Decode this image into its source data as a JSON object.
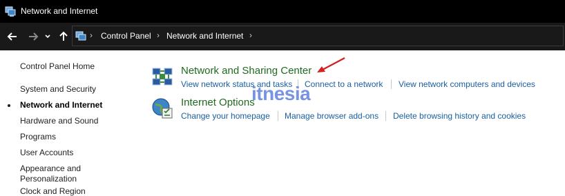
{
  "window": {
    "title": "Network and Internet"
  },
  "nav": {
    "back_icon": "back-arrow-icon",
    "forward_icon": "forward-arrow-icon",
    "recent_icon": "chevron-down-icon",
    "up_icon": "up-arrow-icon"
  },
  "address": {
    "crumbs": [
      "Control Panel",
      "Network and Internet"
    ],
    "separator": "›"
  },
  "sidebar": {
    "home": "Control Panel Home",
    "items": [
      {
        "label": "System and Security"
      },
      {
        "label": "Network and Internet",
        "current": true
      },
      {
        "label": "Hardware and Sound"
      },
      {
        "label": "Programs"
      },
      {
        "label": "User Accounts"
      },
      {
        "label": "Appearance and Personalization"
      },
      {
        "label": "Clock and Region"
      }
    ]
  },
  "categories": [
    {
      "title": "Network and Sharing Center",
      "icon": "network-sharing-icon",
      "tasks": [
        "View network status and tasks",
        "Connect to a network",
        "View network computers and devices"
      ]
    },
    {
      "title": "Internet Options",
      "icon": "internet-options-icon",
      "tasks": [
        "Change your homepage",
        "Manage browser add-ons",
        "Delete browsing history and cookies"
      ]
    }
  ],
  "watermark": "itnesia",
  "colors": {
    "titlebar_bg": "#000000",
    "navbar_bg": "#191919",
    "category_title": "#1e6b1e",
    "task_link": "#1a5fa0",
    "annotation_arrow": "#d42020"
  }
}
